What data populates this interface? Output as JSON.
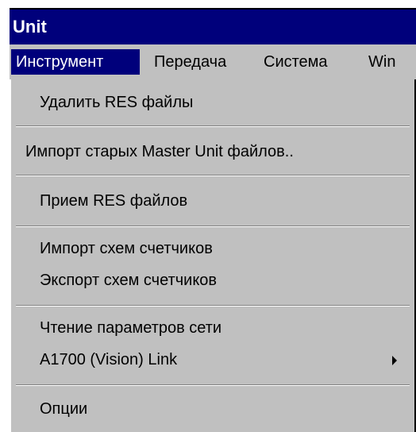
{
  "window": {
    "title": "Unit"
  },
  "menubar": {
    "items": [
      {
        "label": "Инструмент",
        "active": true
      },
      {
        "label": "Передача"
      },
      {
        "label": "Система"
      },
      {
        "label": "Win"
      }
    ]
  },
  "dropdown": {
    "items": [
      {
        "label": "Удалить RES файлы"
      },
      {
        "label": "Импорт старых Master Unit файлов.."
      },
      {
        "label": "Прием RES файлов"
      },
      {
        "label": "Импорт схем счетчиков"
      },
      {
        "label": "Экспорт схем счетчиков"
      },
      {
        "label": "Чтение параметров сети"
      },
      {
        "label": "A1700 (Vision) Link",
        "submenu": true
      },
      {
        "label": "Опции"
      }
    ]
  },
  "colors": {
    "titlebar": "#00007b",
    "menu_background": "#c0c0c0",
    "highlight": "#00007b"
  },
  "icons": {
    "submenu": "submenu-arrow-icon"
  }
}
